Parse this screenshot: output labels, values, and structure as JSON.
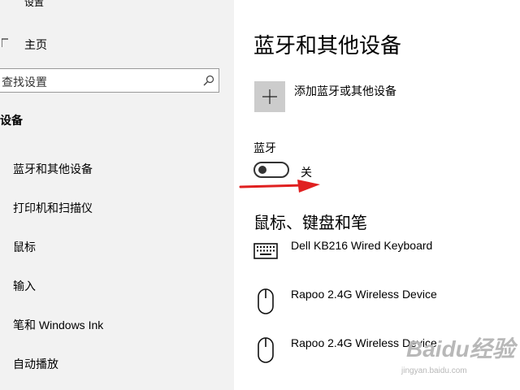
{
  "sidebar": {
    "cut_title": "设置",
    "home_label": "主页",
    "search_placeholder": "查找设置",
    "section_title": "设备",
    "items": [
      {
        "label": "蓝牙和其他设备"
      },
      {
        "label": "打印机和扫描仪"
      },
      {
        "label": "鼠标"
      },
      {
        "label": "输入"
      },
      {
        "label": "笔和 Windows Ink"
      },
      {
        "label": "自动播放"
      }
    ]
  },
  "main": {
    "title": "蓝牙和其他设备",
    "add_device_label": "添加蓝牙或其他设备",
    "bluetooth_label": "蓝牙",
    "bluetooth_state": "关",
    "bluetooth_on": false,
    "peripherals_title": "鼠标、键盘和笔",
    "devices": [
      {
        "name": "Dell KB216 Wired Keyboard",
        "icon": "keyboard-icon"
      },
      {
        "name": "Rapoo 2.4G Wireless Device",
        "icon": "mouse-icon"
      },
      {
        "name": "Rapoo 2.4G Wireless Device",
        "icon": "mouse-icon"
      }
    ]
  },
  "annotation": {
    "arrow_color": "#e02020"
  },
  "watermark": {
    "main": "Baidu经验",
    "sub": "jingyan.baidu.com"
  }
}
